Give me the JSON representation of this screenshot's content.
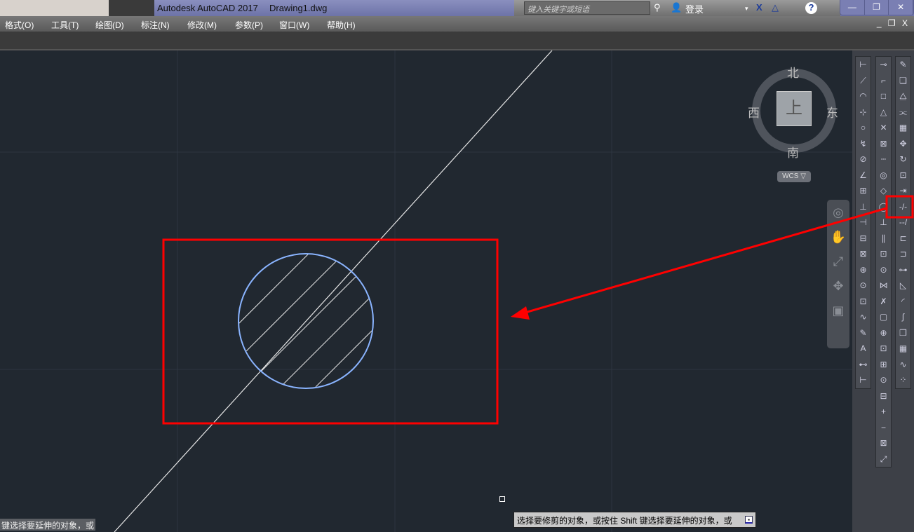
{
  "title": {
    "app": "Autodesk AutoCAD 2017",
    "document": "Drawing1.dwg"
  },
  "infocenter": {
    "search_placeholder": "键入关键字或短语",
    "login": "登录"
  },
  "window_buttons": [
    "—",
    "❐",
    "✕"
  ],
  "menu": [
    "格式(O)",
    "工具(T)",
    "绘图(D)",
    "标注(N)",
    "修改(M)",
    "参数(P)",
    "窗口(W)",
    "帮助(H)"
  ],
  "mdi_controls": "_ ❐ X",
  "viewcube": {
    "north": "北",
    "south": "南",
    "east": "东",
    "west": "西",
    "top": "上",
    "wcs": "WCS ▽"
  },
  "command_line": "键选择要延伸的对象，或",
  "tooltip": "选择要修剪的对象，或按住 Shift 键选择要延伸的对象，或",
  "colors": {
    "canvas": "#212830",
    "annotation": "#ff0000",
    "circle": "#8ab4ff"
  }
}
